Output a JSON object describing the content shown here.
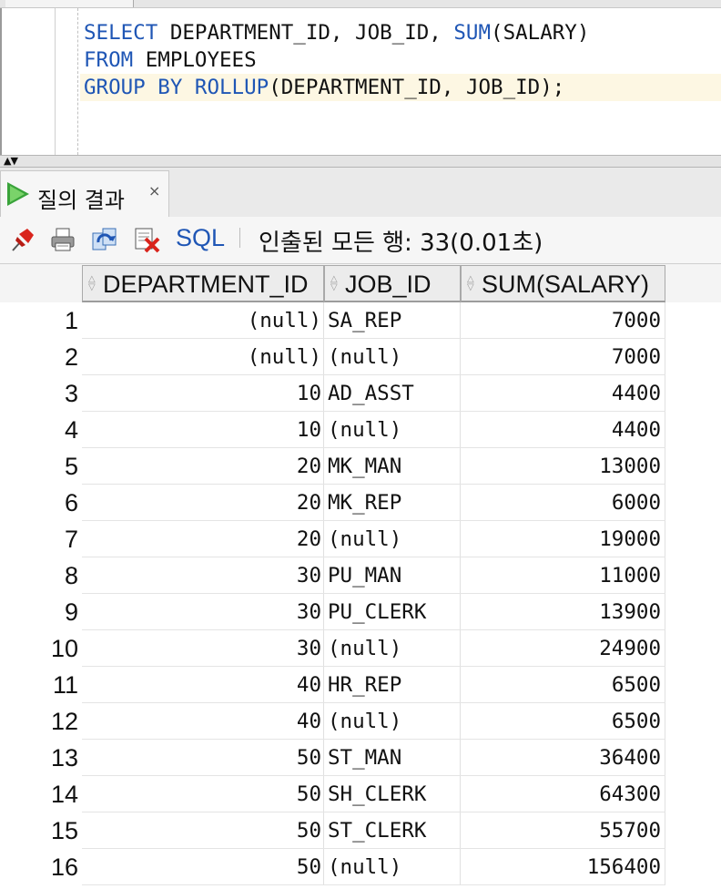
{
  "colors": {
    "keyword": "#1f56b5",
    "current_line": "#fdf7e3",
    "play_green": "#39a33a"
  },
  "editor": {
    "lines": [
      {
        "kw1": "SELECT",
        "t1": " DEPARTMENT_ID, JOB_ID, ",
        "kw2": "SUM",
        "t2": "(SALARY)"
      },
      {
        "kw1": "FROM",
        "t1": " EMPLOYEES",
        "kw2": "",
        "t2": ""
      },
      {
        "kw1": "GROUP BY ROLLUP",
        "t1": "(DEPARTMENT_ID, JOB_ID);",
        "kw2": "",
        "t2": ""
      }
    ]
  },
  "results_tab": {
    "label": "질의 결과",
    "close": "×",
    "icon": "play-icon"
  },
  "toolbar": {
    "icons": [
      "pin-icon",
      "print-icon",
      "refresh-icon",
      "cancel-icon"
    ],
    "sql_label": "SQL",
    "status": "인출된 모든 행: 33(0.01초)"
  },
  "grid": {
    "columns": [
      "DEPARTMENT_ID",
      "JOB_ID",
      "SUM(SALARY)"
    ],
    "rows": [
      {
        "n": "1",
        "dept": "(null)",
        "job": "SA_REP",
        "sal": "7000"
      },
      {
        "n": "2",
        "dept": "(null)",
        "job": "(null)",
        "sal": "7000"
      },
      {
        "n": "3",
        "dept": "10",
        "job": "AD_ASST",
        "sal": "4400"
      },
      {
        "n": "4",
        "dept": "10",
        "job": "(null)",
        "sal": "4400"
      },
      {
        "n": "5",
        "dept": "20",
        "job": "MK_MAN",
        "sal": "13000"
      },
      {
        "n": "6",
        "dept": "20",
        "job": "MK_REP",
        "sal": "6000"
      },
      {
        "n": "7",
        "dept": "20",
        "job": "(null)",
        "sal": "19000"
      },
      {
        "n": "8",
        "dept": "30",
        "job": "PU_MAN",
        "sal": "11000"
      },
      {
        "n": "9",
        "dept": "30",
        "job": "PU_CLERK",
        "sal": "13900"
      },
      {
        "n": "10",
        "dept": "30",
        "job": "(null)",
        "sal": "24900"
      },
      {
        "n": "11",
        "dept": "40",
        "job": "HR_REP",
        "sal": "6500"
      },
      {
        "n": "12",
        "dept": "40",
        "job": "(null)",
        "sal": "6500"
      },
      {
        "n": "13",
        "dept": "50",
        "job": "ST_MAN",
        "sal": "36400"
      },
      {
        "n": "14",
        "dept": "50",
        "job": "SH_CLERK",
        "sal": "64300"
      },
      {
        "n": "15",
        "dept": "50",
        "job": "ST_CLERK",
        "sal": "55700"
      },
      {
        "n": "16",
        "dept": "50",
        "job": "(null)",
        "sal": "156400"
      }
    ]
  }
}
